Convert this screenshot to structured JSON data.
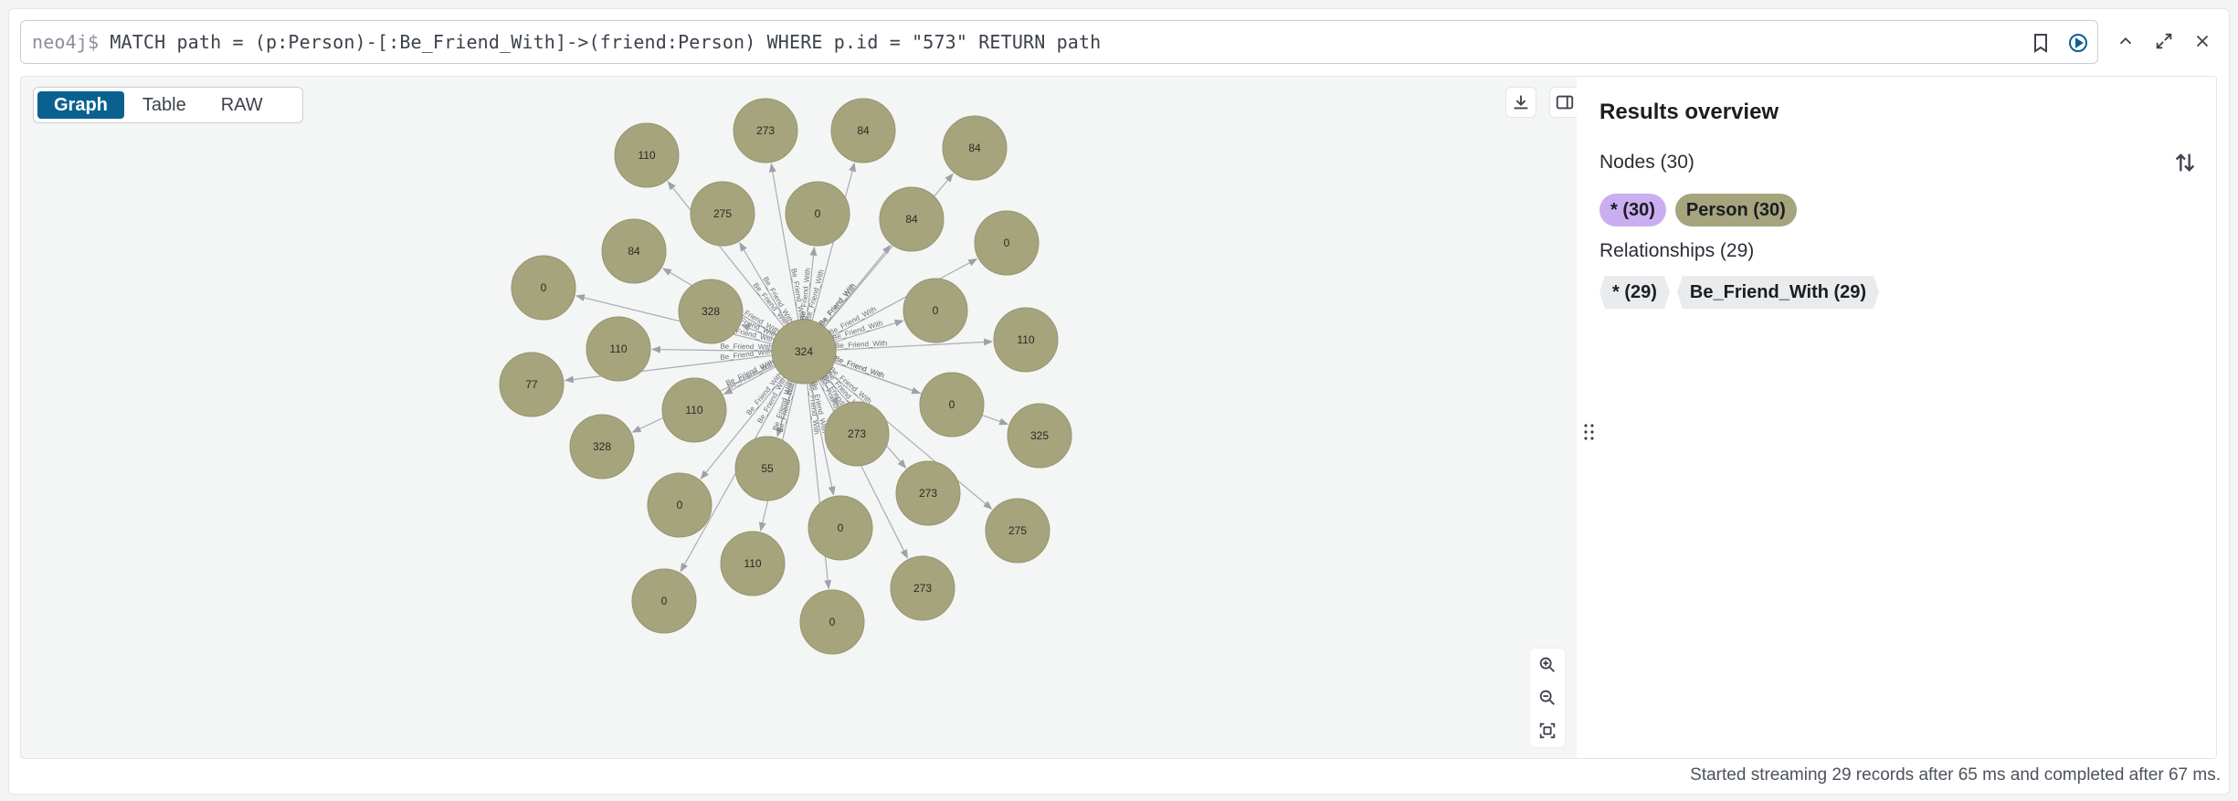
{
  "query": {
    "prompt": "neo4j$",
    "text": " MATCH path = (p:Person)-[:Be_Friend_With]->(friend:Person) WHERE p.id = \"573\" RETURN path"
  },
  "view_tabs": [
    "Graph",
    "Table",
    "RAW"
  ],
  "active_tab": "Graph",
  "graph": {
    "center": {
      "label": "324"
    },
    "relationship_label": "Be_Friend_With",
    "node_color": "#a5a47d",
    "friends": [
      {
        "label": "110"
      },
      {
        "label": "273"
      },
      {
        "label": "84"
      },
      {
        "label": "84"
      },
      {
        "label": "0"
      },
      {
        "label": "110"
      },
      {
        "label": "325"
      },
      {
        "label": "275"
      },
      {
        "label": "273"
      },
      {
        "label": "0"
      },
      {
        "label": "0"
      },
      {
        "label": "77"
      },
      {
        "label": "0"
      },
      {
        "label": "275"
      },
      {
        "label": "0"
      },
      {
        "label": "84"
      },
      {
        "label": "328"
      },
      {
        "label": "110"
      },
      {
        "label": "110"
      },
      {
        "label": "328"
      },
      {
        "label": "0"
      },
      {
        "label": "84"
      },
      {
        "label": "0"
      },
      {
        "label": "0"
      },
      {
        "label": "273"
      },
      {
        "label": "273"
      },
      {
        "label": "0"
      },
      {
        "label": "55"
      },
      {
        "label": "110"
      }
    ]
  },
  "overview": {
    "title": "Results overview",
    "nodes_heading": "Nodes (30)",
    "node_pills": [
      {
        "label": "* (30)",
        "color": "#c9aef0"
      },
      {
        "label": "Person (30)",
        "color": "#a5a47d"
      }
    ],
    "rels_heading": "Relationships (29)",
    "rel_tags": [
      "* (29)",
      "Be_Friend_With (29)"
    ]
  },
  "status": "Started streaming 29 records after 65 ms and completed after 67 ms."
}
